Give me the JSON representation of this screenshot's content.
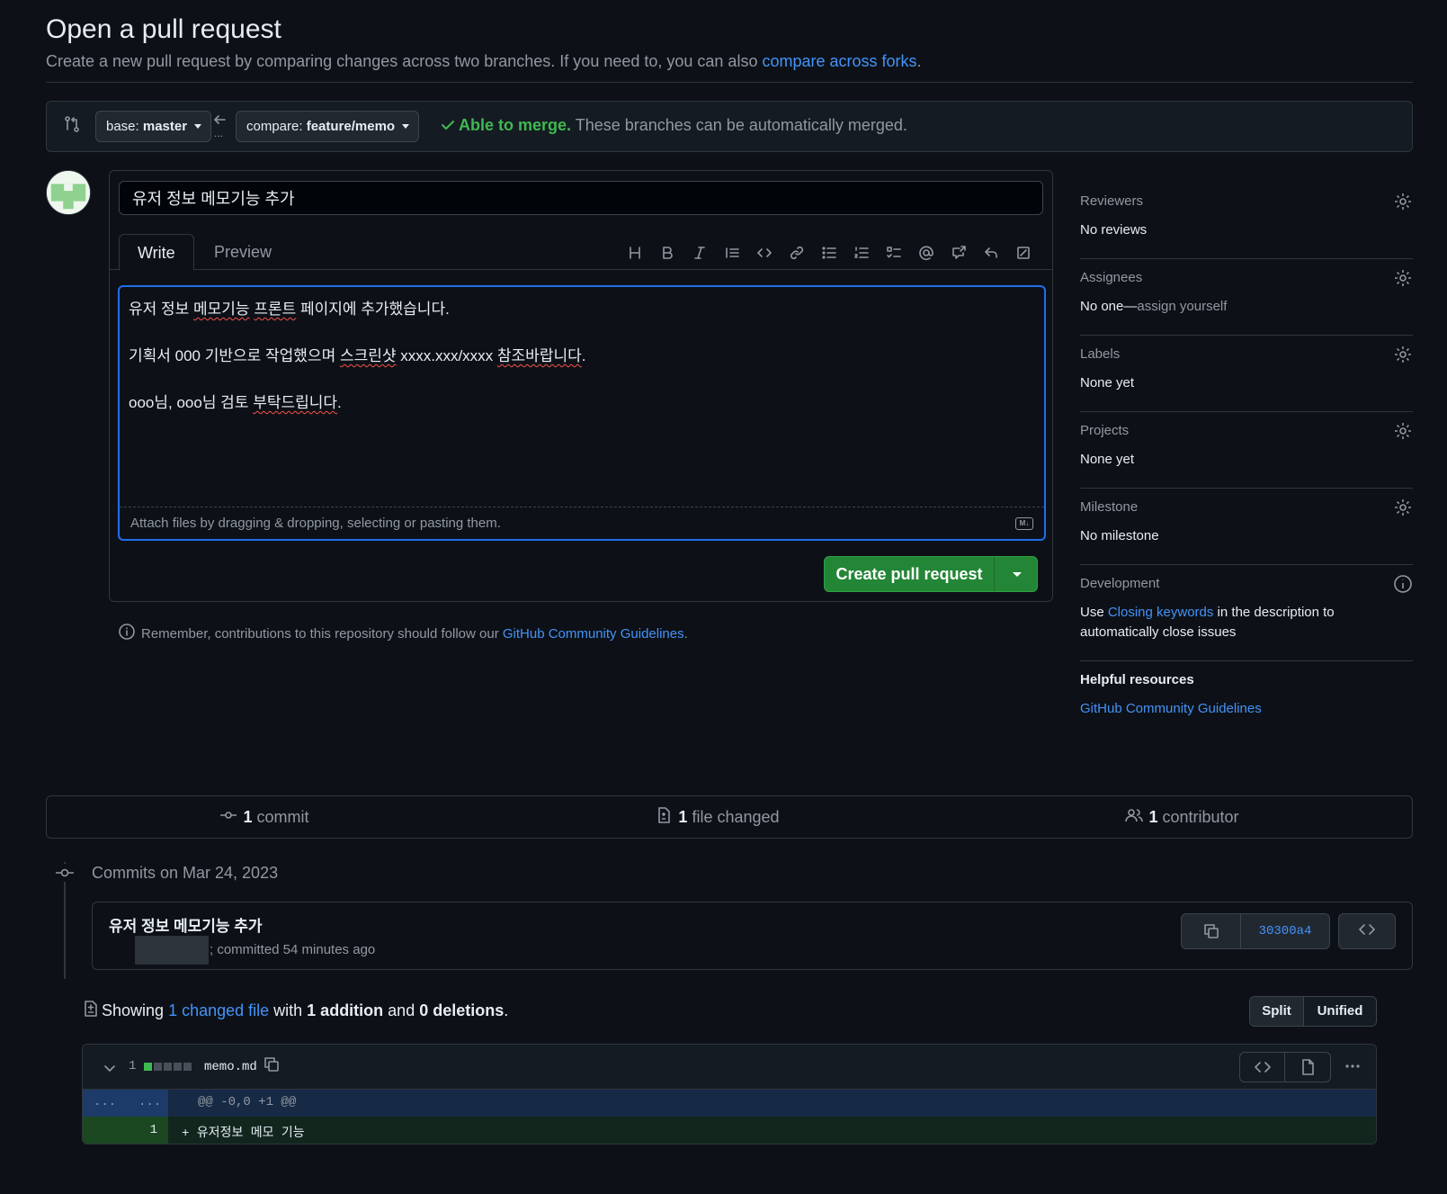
{
  "header": {
    "title": "Open a pull request",
    "subtitle_prefix": "Create a new pull request by comparing changes across two branches. If you need to, you can also ",
    "subtitle_link": "compare across forks",
    "subtitle_suffix": "."
  },
  "compare": {
    "base_prefix": "base: ",
    "base_branch": "master",
    "compare_prefix": "compare: ",
    "compare_branch": "feature/memo",
    "status_ok": "Able to merge.",
    "status_text": " These branches can be automatically merged.",
    "arrow_dots": "..."
  },
  "editor": {
    "title_value": "유저 정보 메모기능 추가",
    "tab_write": "Write",
    "tab_preview": "Preview",
    "body_line1_a": "유저 정보 ",
    "body_line1_b": "메모기능",
    "body_line1_c": " ",
    "body_line1_d": "프론트",
    "body_line1_e": " 페이지에 추가했습니다.",
    "body_line2_a": "기획서 000 기반으로 작업했으며 ",
    "body_line2_b": "스크린샷",
    "body_line2_c": " xxxx.xxx/xxxx ",
    "body_line2_d": "참조바랍니다",
    "body_line2_e": ".",
    "body_line3_a": "ooo님, ooo님 검토 ",
    "body_line3_b": "부탁드립니다",
    "body_line3_c": ".",
    "attach_hint": "Attach files by dragging & dropping, selecting or pasting them.",
    "md_badge": "M↓",
    "create_label": "Create pull request"
  },
  "remember": {
    "prefix": "Remember, contributions to this repository should follow our ",
    "link": "GitHub Community Guidelines",
    "suffix": "."
  },
  "sidebar": {
    "reviewers": {
      "head": "Reviewers",
      "value": "No reviews"
    },
    "assignees": {
      "head": "Assignees",
      "value_a": "No one—",
      "value_b": "assign yourself"
    },
    "labels": {
      "head": "Labels",
      "value": "None yet"
    },
    "projects": {
      "head": "Projects",
      "value": "None yet"
    },
    "milestone": {
      "head": "Milestone",
      "value": "No milestone"
    },
    "development": {
      "head": "Development",
      "value_a": "Use ",
      "link": "Closing keywords",
      "value_b": " in the description to automatically close issues"
    },
    "helpful": {
      "head": "Helpful resources",
      "link": "GitHub Community Guidelines"
    }
  },
  "stats": {
    "commits_num": "1",
    "commits_label": " commit",
    "files_num": "1",
    "files_label": " file changed",
    "contrib_num": "1",
    "contrib_label": " contributor"
  },
  "commits": {
    "date_head": "Commits on Mar 24, 2023",
    "title": "유저 정보 메모기능 추가",
    "meta": "; committed 54 minutes ago",
    "sha": "30300a4"
  },
  "showing": {
    "prefix": "Showing ",
    "link": "1 changed file",
    "mid1": " with ",
    "additions": "1 addition",
    "mid2": " and ",
    "deletions": "0 deletions",
    "suffix": ".",
    "split": "Split",
    "unified": "Unified"
  },
  "diff": {
    "count": "1",
    "file": "memo.md",
    "hunk_left": "...",
    "hunk_right": "...",
    "hunk_header": "@@ -0,0 +1 @@",
    "line_num": "1",
    "line_text": "+ 유저정보 메모 기능"
  },
  "colors": {
    "accent": "#4493f8",
    "success": "#3fb950",
    "button_green": "#238636",
    "background": "#0d1117"
  }
}
